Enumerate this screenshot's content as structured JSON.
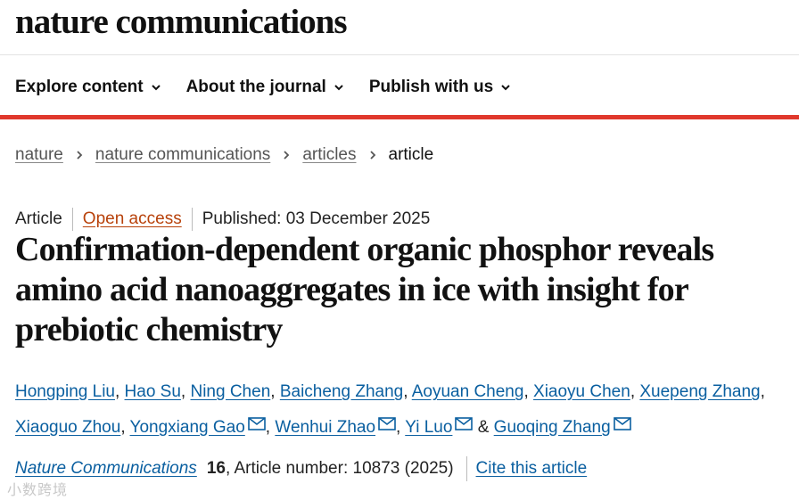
{
  "header": {
    "logo_text": "nature communications"
  },
  "nav": {
    "items": [
      {
        "label": "Explore content"
      },
      {
        "label": "About the journal"
      },
      {
        "label": "Publish with us"
      }
    ]
  },
  "breadcrumb": {
    "links": [
      "nature",
      "nature communications",
      "articles"
    ],
    "current": "article"
  },
  "article": {
    "type": "Article",
    "access": "Open access",
    "published": "Published: 03 December 2025",
    "title": "Confirmation-dependent organic phosphor reveals amino acid nanoaggregates in ice with insight for prebiotic chemistry",
    "authors": [
      "Hongping Liu",
      "Hao Su",
      "Ning Chen",
      "Baicheng Zhang",
      "Aoyuan Cheng",
      "Xiaoyu Chen",
      "Xuepeng Zhang",
      "Xiaoguo Zhou",
      "Yongxiang Gao",
      "Wenhui Zhao",
      "Yi Luo",
      "Guoqing Zhang"
    ],
    "author_separator": ",",
    "author_conjunction": "&"
  },
  "citation": {
    "journal": "Nature Communications",
    "volume": "16",
    "article_number": ", Article number: 10873 (2025)",
    "cite_label": "Cite this article"
  },
  "watermark": {
    "text": "小数跨境"
  },
  "colors": {
    "accent_red": "#e0382c",
    "link_blue": "#0a5fa0",
    "open_access_orange": "#b8420b"
  }
}
